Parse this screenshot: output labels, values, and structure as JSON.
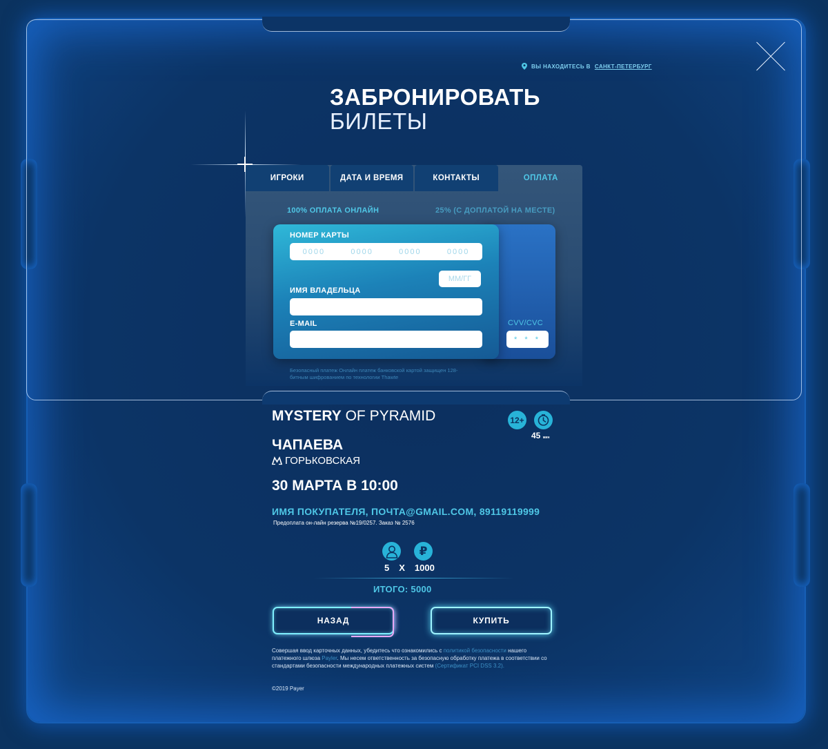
{
  "header": {
    "location_prefix": "ВЫ НАХОДИТЕСЬ В",
    "location_city": "САНКТ-ПЕТЕРБУРГ",
    "title_line1": "ЗАБРОНИРОВАТЬ",
    "title_line2": "БИЛЕТЫ"
  },
  "tabs": [
    {
      "label": "ИГРОКИ"
    },
    {
      "label": "ДАТА И ВРЕМЯ"
    },
    {
      "label": "КОНТАКТЫ"
    },
    {
      "label": "ОПЛАТА",
      "active": true
    }
  ],
  "payment": {
    "option_full": "100% ОПЛАТА ОНЛАЙН",
    "option_partial": "25% (С ДОПЛАТОЙ НА МЕСТЕ)",
    "card_number_label": "НОМЕР КАРТЫ",
    "card_number_groups": [
      "0000",
      "0000",
      "0000",
      "0000"
    ],
    "expiry_placeholder": "ММ/ГГ",
    "holder_label": "ИМЯ ВЛАДЕЛЬЦА",
    "holder_value": "",
    "email_label": "E-MAIL",
    "email_value": "",
    "cvv_label": "CVV/CVC",
    "cvv_placeholder": "* * *",
    "secure_note": "Безопасный платеж Онлайн платеж банковской картой защищен 128-битным шифрованием по технологии Thawte"
  },
  "summary": {
    "game_bold": "MYSTERY",
    "game_rest": " OF PYRAMID",
    "age": "12+",
    "duration": "45",
    "duration_unit": "мин",
    "street": "ЧАПАЕВА",
    "metro": "ГОРЬКОВСКАЯ",
    "datetime": "30 МАРТА В 10:00",
    "buyer": "ИМЯ ПОКУПАТЕЛЯ, ПОЧТА@GMAIL.COM, 89119119999",
    "order_info": "Предоплата он-лайн резерва №19/0257. Заказ № 2576",
    "players": "5",
    "multiply": "X",
    "price": "1000",
    "total": "ИТОГО: 5000"
  },
  "buttons": {
    "back": "НАЗАД",
    "buy": "КУПИТЬ"
  },
  "legal": {
    "part1": "Совершая ввод карточных данных, убедитесь что ознакомились с ",
    "link1": "политикой безопасности",
    "part2": " нашего платежного шлюза ",
    "link2": "Payler",
    "part3": ". Мы несем ответственность за безопасную обработку платежа в соответствии со стандартами безопасности международных платежных систем ",
    "link3": "(Сертификат PCI DSS 3.2).",
    "copyright": "©2019 Payer"
  },
  "colors": {
    "background": "#0b3360",
    "accent": "#4fc7e6",
    "badge": "#28b3d8"
  }
}
